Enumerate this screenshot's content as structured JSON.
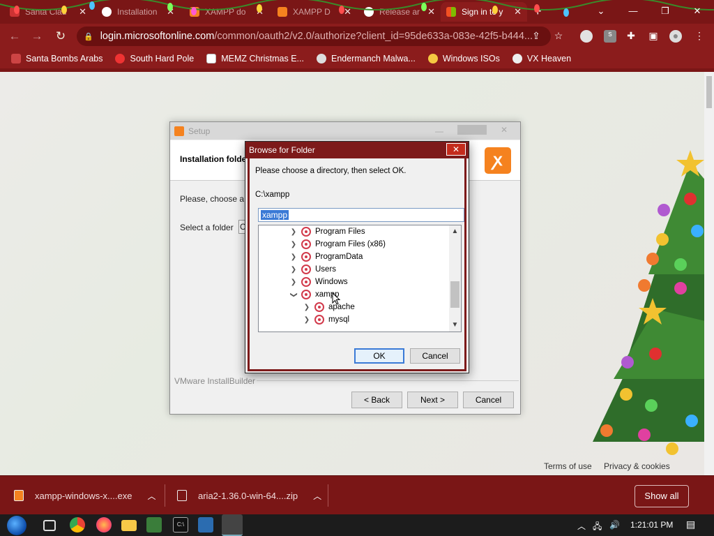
{
  "browser": {
    "tabs": [
      {
        "title": "Santa Clau",
        "active": false
      },
      {
        "title": "Installation",
        "active": false
      },
      {
        "title": "XAMPP do",
        "active": false
      },
      {
        "title": "XAMPP D",
        "active": false
      },
      {
        "title": "Release ar",
        "active": false
      },
      {
        "title": "Sign in to y",
        "active": true
      }
    ],
    "url_host": "login.microsoftonline.com",
    "url_path": "/common/oauth2/v2.0/authorize?client_id=95de633a-083e-42f5-b444...",
    "bookmarks": [
      {
        "label": "Santa Bombs Arabs",
        "icon": "santa-icon"
      },
      {
        "label": "South Hard Pole",
        "icon": "flower-icon"
      },
      {
        "label": "MEMZ Christmas E...",
        "icon": "memz-icon"
      },
      {
        "label": "Endermanch Malwa...",
        "icon": "raccoon-icon"
      },
      {
        "label": "Windows ISOs",
        "icon": "bulb-icon"
      },
      {
        "label": "VX Heaven",
        "icon": "skull-icon"
      }
    ],
    "accent": "#8b1c1c"
  },
  "page": {
    "footer_terms": "Terms of use",
    "footer_privacy": "Privacy & cookies"
  },
  "setup": {
    "title": "Setup",
    "header_title": "Installation folde",
    "prompt": "Please, choose a f",
    "select_label": "Select a folder",
    "select_value": "C",
    "builder_label": "VMware InstallBuilder",
    "back": "< Back",
    "next": "Next >",
    "cancel": "Cancel"
  },
  "browse_dialog": {
    "title": "Browse for Folder",
    "instruction": "Please choose a directory, then select OK.",
    "current_path": "C:\\xampp",
    "folder_name": "xampp",
    "tree": [
      {
        "label": "Program Files",
        "expanded": false,
        "level": 0
      },
      {
        "label": "Program Files (x86)",
        "expanded": false,
        "level": 0
      },
      {
        "label": "ProgramData",
        "expanded": false,
        "level": 0
      },
      {
        "label": "Users",
        "expanded": false,
        "level": 0
      },
      {
        "label": "Windows",
        "expanded": false,
        "level": 0
      },
      {
        "label": "xampp",
        "expanded": true,
        "level": 0
      },
      {
        "label": "apache",
        "expanded": false,
        "level": 1
      },
      {
        "label": "mysql",
        "expanded": false,
        "level": 1
      }
    ],
    "ok": "OK",
    "cancel": "Cancel"
  },
  "downloads": [
    {
      "name": "xampp-windows-x....exe"
    },
    {
      "name": "aria2-1.36.0-win-64....zip"
    }
  ],
  "show_all": "Show all",
  "taskbar": {
    "clock": "1:21:01 PM"
  }
}
